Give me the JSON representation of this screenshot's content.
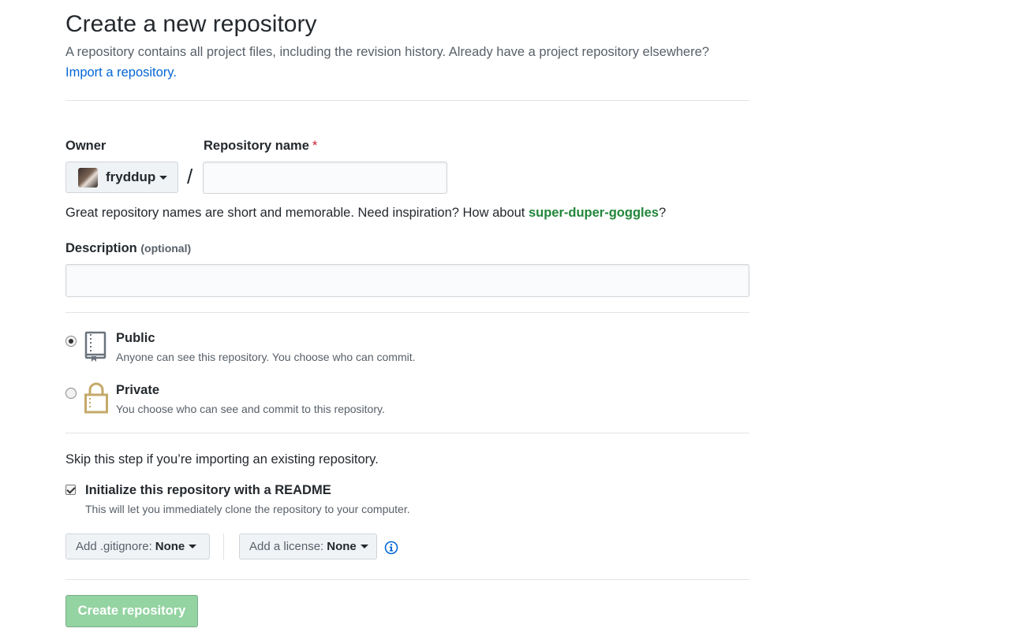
{
  "header": {
    "title": "Create a new repository",
    "subtitle": "A repository contains all project files, including the revision history. Already have a project repository elsewhere?",
    "import_link": "Import a repository."
  },
  "owner": {
    "label": "Owner",
    "selected": "fryddup"
  },
  "repo_name": {
    "label": "Repository name",
    "required_mark": "*",
    "value": "",
    "placeholder": "",
    "separator": "/"
  },
  "name_hint": {
    "text": "Great repository names are short and memorable. Need inspiration? How about ",
    "suggestion": "super-duper-goggles",
    "suffix": "?"
  },
  "description": {
    "label": "Description",
    "optional": "(optional)",
    "value": "",
    "placeholder": ""
  },
  "visibility": {
    "public": {
      "title": "Public",
      "desc": "Anyone can see this repository. You choose who can commit.",
      "checked": true,
      "icon": "repo-icon"
    },
    "private": {
      "title": "Private",
      "desc": "You choose who can see and commit to this repository.",
      "checked": false,
      "icon": "lock-icon"
    }
  },
  "init": {
    "skip_text": "Skip this step if you’re importing an existing repository.",
    "readme_label": "Initialize this repository with a README",
    "readme_desc": "This will let you immediately clone the repository to your computer.",
    "readme_checked": true
  },
  "gitignore": {
    "prefix": "Add .gitignore:",
    "value": "None"
  },
  "license": {
    "prefix": "Add a license:",
    "value": "None"
  },
  "submit": {
    "label": "Create repository",
    "disabled": true
  },
  "colors": {
    "link": "#0366d6",
    "suggestion": "#22863a",
    "required": "#cb2431",
    "create_button": "#94d3a2",
    "private_icon": "#c4a96a"
  }
}
